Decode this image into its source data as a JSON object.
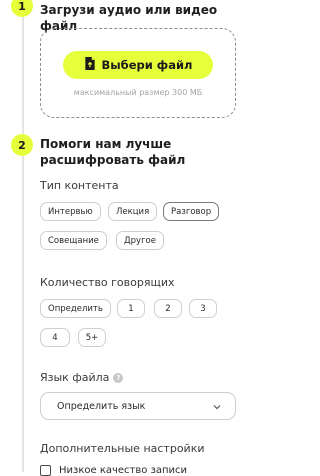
{
  "steps": [
    {
      "number": "1",
      "title": "Загрузи аудио или видео файл"
    },
    {
      "number": "2",
      "title": "Помоги нам лучше расшифровать файл"
    }
  ],
  "upload": {
    "button_label": "Выбери файл",
    "hint": "максимальный размер 300 МБ",
    "icon": "file-upload-icon"
  },
  "content_type": {
    "label": "Тип контента",
    "options": [
      "Интервью",
      "Лекция",
      "Разговор",
      "Совещание",
      "Другое"
    ],
    "selected": "Разговор"
  },
  "speakers": {
    "label": "Количество говорящих",
    "options": [
      "Определить",
      "1",
      "2",
      "3",
      "4",
      "5+"
    ]
  },
  "language": {
    "label": "Язык файла",
    "help_icon": "question-icon",
    "help_symbol": "?",
    "value": "Определить язык",
    "icon": "chevron-down-icon"
  },
  "advanced": {
    "label": "Дополнительные настройки",
    "checkbox_label": "Низкое качество записи"
  },
  "colors": {
    "accent": "#e6ff3b",
    "border": "#cfcfcf",
    "hint": "#a3a3a3"
  }
}
